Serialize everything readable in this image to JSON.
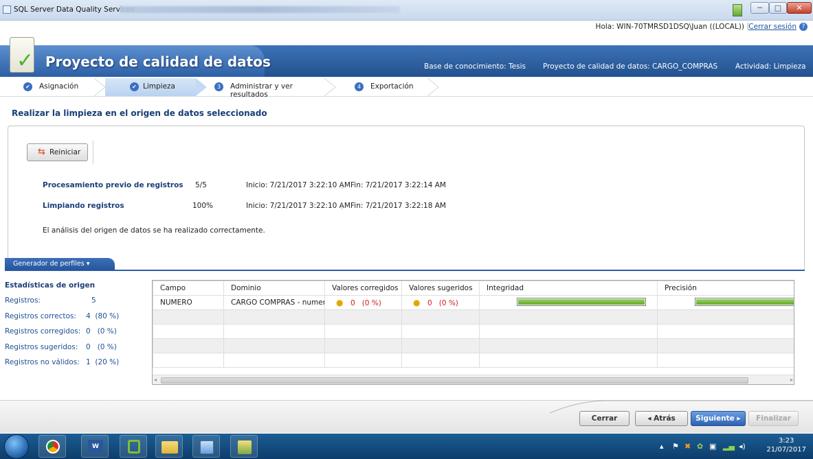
{
  "window": {
    "title": "SQL Server Data Quality Services",
    "minimize": "─",
    "maximize": "□",
    "close": "✕"
  },
  "greeting": {
    "user": "Hola: WIN-70TMRSD1DSQ\\Juan ((LOCAL))",
    "separator": "|",
    "logout": "Cerrar sesión",
    "help": "?"
  },
  "banner": {
    "title": "Proyecto de calidad de datos",
    "knowledge_base": "Base de conocimiento: Tesis",
    "project": "Proyecto de calidad de datos: CARGO_COMPRAS",
    "activity": "Actividad: Limpieza"
  },
  "steps": [
    {
      "label": "Asignación",
      "marker": "✔"
    },
    {
      "label": "Limpieza",
      "marker": "✔"
    },
    {
      "label": "Administrar y ver resultados",
      "marker": "3"
    },
    {
      "label": "Exportación",
      "marker": "4"
    }
  ],
  "heading": "Realizar la limpieza en el origen de datos seleccionado",
  "restart_label": "Reiniciar",
  "progress": [
    {
      "label": "Procesamiento previo de registros",
      "value": "5/5",
      "start": "Inicio: 7/21/2017 3:22:10 AM",
      "end": "Fin: 7/21/2017 3:22:14 AM"
    },
    {
      "label": "Limpiando registros",
      "value": "100%",
      "start": "Inicio: 7/21/2017 3:22:10 AM",
      "end": "Fin: 7/21/2017 3:22:18 AM"
    }
  ],
  "status_message": "El análisis del origen de datos se ha realizado correctamente.",
  "profiler_tab": "Generador de perfiles",
  "stats": {
    "title": "Estadísticas de origen",
    "rows": [
      {
        "label": "Registros:",
        "value": "5"
      },
      {
        "label": "Registros correctos:",
        "value": "4  (80 %)"
      },
      {
        "label": "Registros corregidos:",
        "value": "0   (0 %)"
      },
      {
        "label": "Registros sugeridos:",
        "value": "0   (0 %)"
      },
      {
        "label": "Registros no válidos:",
        "value": "1  (20 %)"
      }
    ]
  },
  "grid": {
    "columns": [
      "Campo",
      "Dominio",
      "Valores corregidos",
      "Valores sugeridos",
      "Integridad",
      "Precisión"
    ],
    "row": {
      "campo": "NUMERO",
      "dominio": "CARGO COMPRAS - numero",
      "corregidos_count": "0",
      "corregidos_pct": "(0 %)",
      "sugeridos_count": "0",
      "sugeridos_pct": "(0 %)",
      "integridad": 1.0,
      "precision": 1.0
    }
  },
  "footer": {
    "close": "Cerrar",
    "back": "◂ Atrás",
    "next": "Siguiente ▸",
    "finish": "Finalizar"
  },
  "taskbar": {
    "time": "3:23",
    "date": "21/07/2017"
  }
}
